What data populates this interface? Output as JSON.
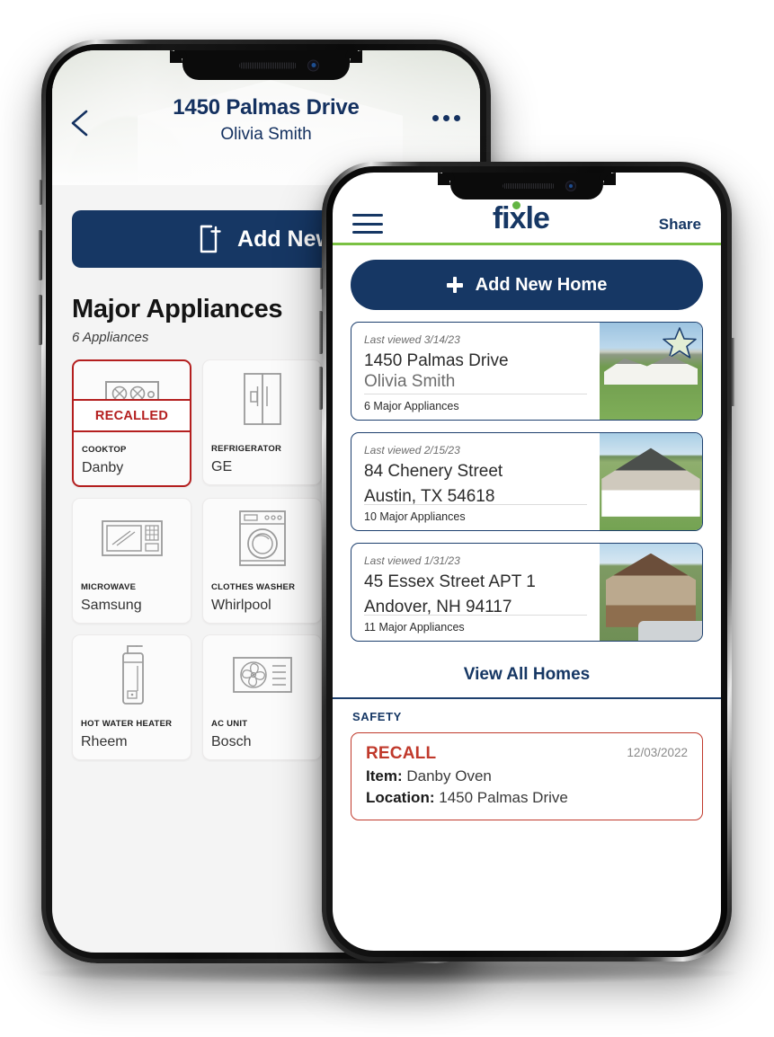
{
  "back_phone": {
    "header": {
      "back_icon": "chevron-left-icon",
      "title": "1450 Palmas Drive",
      "subtitle": "Olivia Smith",
      "more_icon": "more-horizontal-icon"
    },
    "add_new_button": {
      "label": "Add New",
      "icon": "document-plus-icon"
    },
    "section": {
      "heading": "Major Appliances",
      "count": "6 Appliances"
    },
    "recalled_badge": "RECALLED",
    "appliances": [
      {
        "category": "COOKTOP",
        "brand": "Danby",
        "icon": "cooktop-icon",
        "recalled": true
      },
      {
        "category": "REFRIGERATOR",
        "brand": "GE",
        "icon": "refrigerator-icon",
        "recalled": false
      },
      {
        "category": "MICROWAVE",
        "brand": "Samsung",
        "icon": "microwave-icon",
        "recalled": false
      },
      {
        "category": "CLOTHES WASHER",
        "brand": "Whirlpool",
        "icon": "washing-machine-icon",
        "recalled": false
      },
      {
        "category": "HOT WATER HEATER",
        "brand": "Rheem",
        "icon": "water-heater-icon",
        "recalled": false
      },
      {
        "category": "AC UNIT",
        "brand": "Bosch",
        "icon": "ac-unit-icon",
        "recalled": false
      }
    ]
  },
  "front_phone": {
    "topbar": {
      "menu_icon": "hamburger-menu-icon",
      "logo": "fixle",
      "share_label": "Share"
    },
    "add_home_button": {
      "label": "Add New Home",
      "icon": "plus-icon"
    },
    "homes": [
      {
        "last_viewed": "Last viewed 3/14/23",
        "address": "1450 Palmas Drive",
        "secondary": "Olivia Smith",
        "appliance_count": "6 Major Appliances",
        "favorite": true
      },
      {
        "last_viewed": "Last viewed 2/15/23",
        "address": "84 Chenery Street",
        "secondary": "Austin, TX 54618",
        "appliance_count": "10 Major Appliances",
        "favorite": false
      },
      {
        "last_viewed": "Last viewed 1/31/23",
        "address": "45 Essex Street APT 1",
        "secondary": "Andover, NH 94117",
        "appliance_count": "11 Major Appliances",
        "favorite": false
      }
    ],
    "view_all_label": "View All Homes",
    "safety": {
      "label": "SAFETY",
      "recall": {
        "title": "RECALL",
        "date": "12/03/2022",
        "item_label": "Item:",
        "item_value": "Danby Oven",
        "location_label": "Location:",
        "location_value": "1450 Palmas Drive"
      }
    }
  },
  "colors": {
    "navy": "#163764",
    "green": "#7ac143",
    "red": "#c0392b",
    "recall_red": "#b41f1f"
  }
}
